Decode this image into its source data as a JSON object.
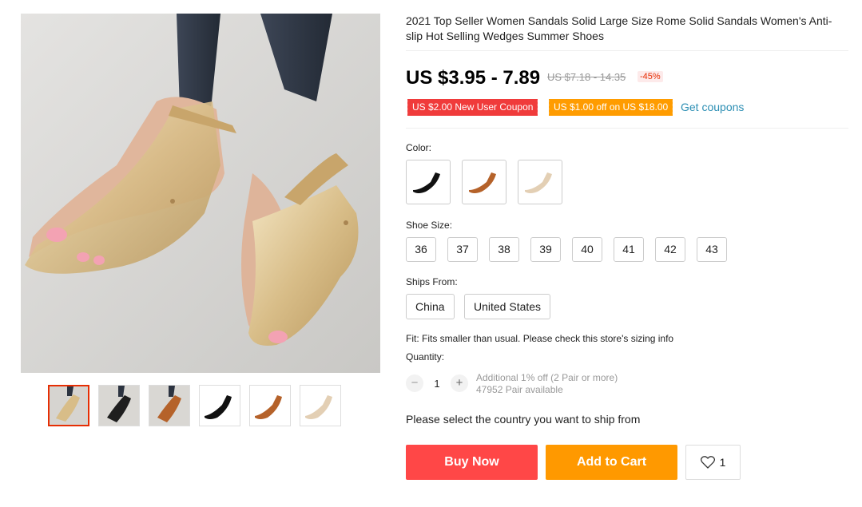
{
  "product": {
    "title": "2021 Top Seller Women Sandals Solid Large Size Rome Solid Sandals Women's Anti-slip Hot Selling Wedges Summer Shoes"
  },
  "pricing": {
    "price": "US $3.95 - 7.89",
    "original": "US $7.18 - 14.35",
    "discount": "-45%"
  },
  "coupons": {
    "new_user": "US $2.00 New User Coupon",
    "store": "US $1.00 off on US $18.00",
    "get_link": "Get coupons"
  },
  "color": {
    "label": "Color:",
    "swatch_icons": [
      "black-sandal-icon",
      "brown-sandal-icon",
      "beige-sandal-icon"
    ]
  },
  "size": {
    "label": "Shoe Size:",
    "options": [
      "36",
      "37",
      "38",
      "39",
      "40",
      "41",
      "42",
      "43"
    ]
  },
  "ships_from": {
    "label": "Ships From:",
    "options": [
      "China",
      "United States"
    ]
  },
  "fit": {
    "text": "Fit: Fits smaller than usual. Please check this store's sizing info"
  },
  "quantity": {
    "label": "Quantity:",
    "value": "1",
    "minus": "−",
    "plus": "+",
    "promo": "Additional 1% off (2 Pair or more)",
    "available": "47952 Pair available"
  },
  "shipping_note": "Please select the country you want to ship from",
  "actions": {
    "buy_now": "Buy Now",
    "add_to_cart": "Add to Cart",
    "wishlist_count": "1"
  },
  "colors": {
    "accent_red": "#ff4747",
    "accent_orange": "#ff9900",
    "price_black": "#000000",
    "link_blue": "#2d8fb4"
  }
}
